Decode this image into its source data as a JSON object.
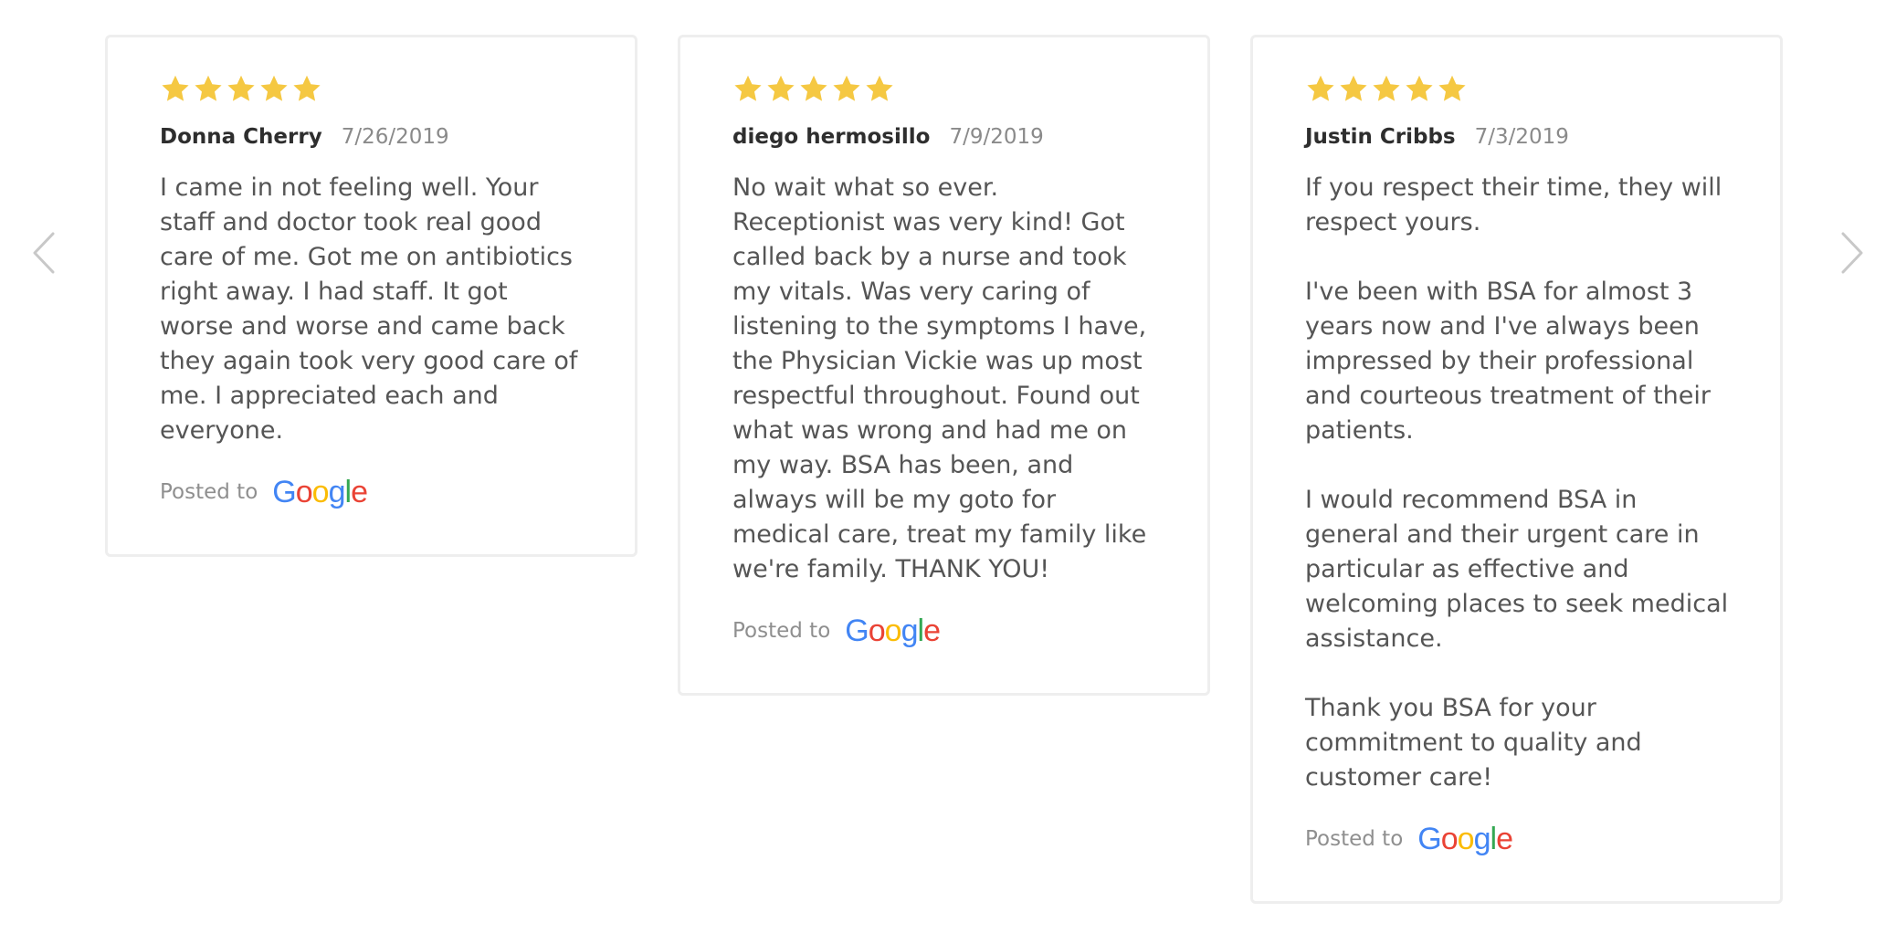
{
  "carousel": {
    "prev_icon": "chevron-left-icon",
    "next_icon": "chevron-right-icon",
    "arrow_color": "#c8c8c8"
  },
  "colors": {
    "star": "#F5C842",
    "card_border": "#eeeeee"
  },
  "reviews": [
    {
      "rating": 5,
      "name": "Donna Cherry",
      "date": "7/26/2019",
      "text": "I came in not feeling well.  Your staff and doctor took real good care of me.  Got me on antibiotics right away.  I had staff.  It got worse and worse and came back they again took very good care of me.  I appreciated each and everyone.",
      "posted_label": "Posted to",
      "source": "Google"
    },
    {
      "rating": 5,
      "name": "diego hermosillo",
      "date": "7/9/2019",
      "text": "No wait what so ever. Receptionist was very kind! Got called back by a nurse and took my vitals. Was very caring of listening to the symptoms I have, the Physician Vickie was up most respectful throughout. Found out what was wrong and had me on my way. BSA has been, and always will be my goto for medical care, treat my family like we're family. THANK YOU!",
      "posted_label": "Posted to",
      "source": "Google"
    },
    {
      "rating": 5,
      "name": "Justin Cribbs",
      "date": "7/3/2019",
      "text": "If you respect their time, they will respect yours.\n\nI've been with BSA for almost 3 years now and I've always been impressed by their professional and courteous treatment of their patients.\n\nI would recommend BSA in general and their urgent care in particular as effective and welcoming places to seek medical assistance.\n\nThank you BSA for your commitment to quality and customer care!",
      "posted_label": "Posted to",
      "source": "Google"
    }
  ]
}
